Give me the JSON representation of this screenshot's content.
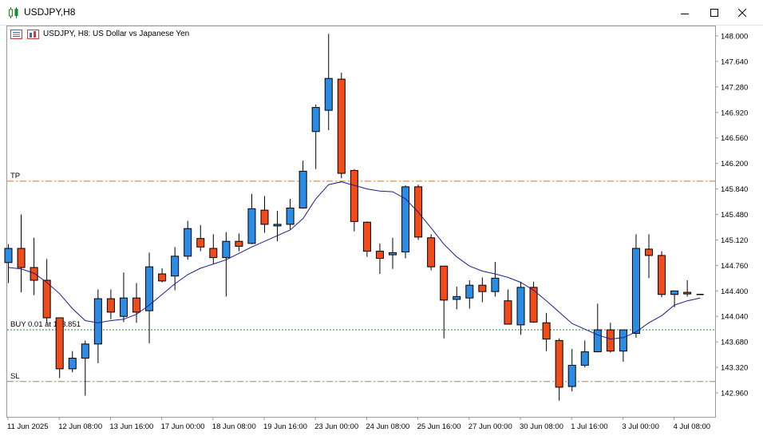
{
  "window": {
    "title": "USDJPY,H8",
    "minimize_icon": "minimize-icon",
    "maximize_icon": "maximize-icon",
    "close_icon": "close-icon"
  },
  "chart_header": {
    "text": "USDJPY, H8:  US Dollar vs Japanese Yen"
  },
  "colors": {
    "bull": "#2b8ce6",
    "bear": "#f04b18",
    "ma_line": "#1c1c8c",
    "tp_sl_line": "#d9702a",
    "buy_line": "#1a8a2a",
    "axis": "#9a9a9a"
  },
  "chart_data": {
    "type": "candlestick",
    "symbol": "USDJPY",
    "timeframe": "H8",
    "y_range": [
      142.7,
      148.2
    ],
    "y_ticks": [
      "148.000",
      "147.640",
      "147.280",
      "146.920",
      "146.560",
      "146.200",
      "145.840",
      "145.480",
      "145.120",
      "144.760",
      "144.400",
      "144.040",
      "143.680",
      "143.320",
      "142.960"
    ],
    "x_tick_labels": [
      {
        "index": 0,
        "label": "11 Jun 2025"
      },
      {
        "index": 4,
        "label": "12 Jun 08:00"
      },
      {
        "index": 8,
        "label": "13 Jun 16:00"
      },
      {
        "index": 12,
        "label": "17 Jun 00:00"
      },
      {
        "index": 16,
        "label": "18 Jun 08:00"
      },
      {
        "index": 20,
        "label": "19 Jun 16:00"
      },
      {
        "index": 24,
        "label": "23 Jun 00:00"
      },
      {
        "index": 28,
        "label": "24 Jun 08:00"
      },
      {
        "index": 32,
        "label": "25 Jun 16:00"
      },
      {
        "index": 36,
        "label": "27 Jun 00:00"
      },
      {
        "index": 40,
        "label": "30 Jun 08:00"
      },
      {
        "index": 44,
        "label": "1 Jul 16:00"
      },
      {
        "index": 48,
        "label": "3 Jul 00:00"
      },
      {
        "index": 52,
        "label": "4 Jul 08:00"
      }
    ],
    "candles": [
      {
        "o": 144.8,
        "h": 145.06,
        "l": 144.51,
        "c": 145.0
      },
      {
        "o": 145.0,
        "h": 145.48,
        "l": 144.38,
        "c": 144.73
      },
      {
        "o": 144.73,
        "h": 145.15,
        "l": 144.34,
        "c": 144.55
      },
      {
        "o": 144.55,
        "h": 144.85,
        "l": 143.94,
        "c": 144.02
      },
      {
        "o": 144.02,
        "h": 144.02,
        "l": 143.17,
        "c": 143.3
      },
      {
        "o": 143.3,
        "h": 143.55,
        "l": 143.25,
        "c": 143.45
      },
      {
        "o": 143.45,
        "h": 143.7,
        "l": 142.92,
        "c": 143.65
      },
      {
        "o": 143.65,
        "h": 144.42,
        "l": 143.38,
        "c": 144.29
      },
      {
        "o": 144.29,
        "h": 144.42,
        "l": 144.0,
        "c": 144.1
      },
      {
        "o": 144.04,
        "h": 144.66,
        "l": 143.96,
        "c": 144.3
      },
      {
        "o": 144.3,
        "h": 144.51,
        "l": 143.95,
        "c": 144.1
      },
      {
        "o": 144.12,
        "h": 144.94,
        "l": 143.66,
        "c": 144.74
      },
      {
        "o": 144.64,
        "h": 144.72,
        "l": 144.52,
        "c": 144.54
      },
      {
        "o": 144.61,
        "h": 145.02,
        "l": 144.41,
        "c": 144.89
      },
      {
        "o": 144.89,
        "h": 145.39,
        "l": 144.84,
        "c": 145.28
      },
      {
        "o": 145.14,
        "h": 145.33,
        "l": 144.96,
        "c": 145.02
      },
      {
        "o": 145.0,
        "h": 145.2,
        "l": 144.78,
        "c": 144.87
      },
      {
        "o": 144.87,
        "h": 145.23,
        "l": 144.32,
        "c": 145.1
      },
      {
        "o": 145.1,
        "h": 145.21,
        "l": 144.96,
        "c": 145.03
      },
      {
        "o": 145.07,
        "h": 145.77,
        "l": 145.06,
        "c": 145.56
      },
      {
        "o": 145.54,
        "h": 145.74,
        "l": 145.22,
        "c": 145.34
      },
      {
        "o": 145.34,
        "h": 145.53,
        "l": 145.1,
        "c": 145.34
      },
      {
        "o": 145.34,
        "h": 145.7,
        "l": 145.27,
        "c": 145.57
      },
      {
        "o": 145.57,
        "h": 146.24,
        "l": 145.56,
        "c": 146.09
      },
      {
        "o": 146.65,
        "h": 147.03,
        "l": 146.12,
        "c": 146.99
      },
      {
        "o": 146.95,
        "h": 148.03,
        "l": 146.67,
        "c": 147.4
      },
      {
        "o": 147.39,
        "h": 147.48,
        "l": 145.99,
        "c": 146.06
      },
      {
        "o": 146.1,
        "h": 146.12,
        "l": 145.24,
        "c": 145.38
      },
      {
        "o": 145.37,
        "h": 145.38,
        "l": 144.88,
        "c": 144.96
      },
      {
        "o": 144.96,
        "h": 145.07,
        "l": 144.64,
        "c": 144.86
      },
      {
        "o": 144.91,
        "h": 145.15,
        "l": 144.71,
        "c": 144.94
      },
      {
        "o": 144.95,
        "h": 145.89,
        "l": 144.86,
        "c": 145.87
      },
      {
        "o": 145.87,
        "h": 145.9,
        "l": 145.12,
        "c": 145.16
      },
      {
        "o": 145.15,
        "h": 145.2,
        "l": 144.69,
        "c": 144.74
      },
      {
        "o": 144.75,
        "h": 144.75,
        "l": 143.73,
        "c": 144.27
      },
      {
        "o": 144.28,
        "h": 144.46,
        "l": 144.14,
        "c": 144.32
      },
      {
        "o": 144.3,
        "h": 144.55,
        "l": 144.15,
        "c": 144.48
      },
      {
        "o": 144.48,
        "h": 144.59,
        "l": 144.24,
        "c": 144.39
      },
      {
        "o": 144.39,
        "h": 144.81,
        "l": 144.32,
        "c": 144.58
      },
      {
        "o": 144.26,
        "h": 144.42,
        "l": 143.93,
        "c": 143.93
      },
      {
        "o": 143.92,
        "h": 144.53,
        "l": 143.78,
        "c": 144.45
      },
      {
        "o": 144.45,
        "h": 144.53,
        "l": 143.95,
        "c": 143.96
      },
      {
        "o": 143.95,
        "h": 144.09,
        "l": 143.55,
        "c": 143.72
      },
      {
        "o": 143.7,
        "h": 143.73,
        "l": 142.85,
        "c": 143.04
      },
      {
        "o": 143.05,
        "h": 143.58,
        "l": 142.98,
        "c": 143.35
      },
      {
        "o": 143.35,
        "h": 143.7,
        "l": 143.32,
        "c": 143.54
      },
      {
        "o": 143.54,
        "h": 144.22,
        "l": 143.53,
        "c": 143.85
      },
      {
        "o": 143.85,
        "h": 143.95,
        "l": 143.53,
        "c": 143.55
      },
      {
        "o": 143.55,
        "h": 143.85,
        "l": 143.4,
        "c": 143.85
      },
      {
        "o": 143.8,
        "h": 145.2,
        "l": 143.74,
        "c": 145.0
      },
      {
        "o": 144.99,
        "h": 145.2,
        "l": 144.58,
        "c": 144.9
      },
      {
        "o": 144.9,
        "h": 144.96,
        "l": 144.31,
        "c": 144.35
      },
      {
        "o": 144.35,
        "h": 144.39,
        "l": 144.17,
        "c": 144.4
      },
      {
        "o": 144.38,
        "h": 144.55,
        "l": 144.32,
        "c": 144.37
      },
      {
        "o": 144.35,
        "h": 144.35,
        "l": 144.35,
        "c": 144.35
      }
    ],
    "moving_average": [
      144.73,
      144.71,
      144.65,
      144.52,
      144.36,
      144.15,
      143.98,
      143.95,
      143.98,
      144.0,
      144.07,
      144.2,
      144.35,
      144.5,
      144.63,
      144.72,
      144.78,
      144.84,
      144.93,
      145.02,
      145.1,
      145.18,
      145.26,
      145.42,
      145.7,
      145.9,
      145.94,
      145.89,
      145.84,
      145.81,
      145.8,
      145.7,
      145.51,
      145.29,
      145.06,
      144.88,
      144.75,
      144.68,
      144.64,
      144.59,
      144.52,
      144.41,
      144.26,
      144.1,
      143.94,
      143.86,
      143.78,
      143.72,
      143.74,
      143.82,
      143.95,
      144.05,
      144.2,
      144.26,
      144.3
    ],
    "levels": [
      {
        "label": "TP",
        "price": 145.95,
        "style": "dash-dot",
        "color_key": "tp_sl_line"
      },
      {
        "label": "BUY 0.01 at 143.851",
        "price": 143.851,
        "style": "dotted",
        "color_key": "buy_line"
      },
      {
        "label": "SL",
        "price": 143.12,
        "style": "dash-dot",
        "color_key": "tp_sl_line"
      }
    ],
    "current_price": 144.35
  }
}
